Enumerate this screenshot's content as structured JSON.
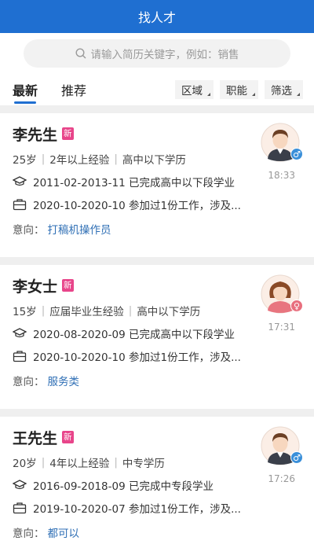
{
  "header": {
    "title": "找人才"
  },
  "search": {
    "placeholder": "请输入简历关键字，例如：销售"
  },
  "tabs": [
    {
      "label": "最新"
    },
    {
      "label": "推荐"
    }
  ],
  "filters": [
    {
      "label": "区域"
    },
    {
      "label": "职能"
    },
    {
      "label": "筛选"
    }
  ],
  "badge_label": "新",
  "intent_label": "意向：",
  "colors": {
    "brand": "#1f6fd1",
    "badge": "#e8458a",
    "male": "#3a8fd9",
    "female": "#e86f7e"
  },
  "candidates": [
    {
      "name": "李先生",
      "age": "25岁",
      "experience": "2年以上经验",
      "education": "高中以下学历",
      "school": "2011-02-2013-11 已完成高中以下段学业",
      "work": "2020-10-2020-10 参加过1份工作，涉及...",
      "intent": "打稿机操作员",
      "time": "18:33",
      "gender": "male"
    },
    {
      "name": "李女士",
      "age": "15岁",
      "experience": "应届毕业生经验",
      "education": "高中以下学历",
      "school": "2020-08-2020-09 已完成高中以下段学业",
      "work": "2020-10-2020-10 参加过1份工作，涉及...",
      "intent": "服务类",
      "time": "17:31",
      "gender": "female"
    },
    {
      "name": "王先生",
      "age": "20岁",
      "experience": "4年以上经验",
      "education": "中专学历",
      "school": "2016-09-2018-09 已完成中专段学业",
      "work": "2019-10-2020-07 参加过1份工作，涉及...",
      "intent": "都可以",
      "time": "17:26",
      "gender": "male"
    }
  ]
}
